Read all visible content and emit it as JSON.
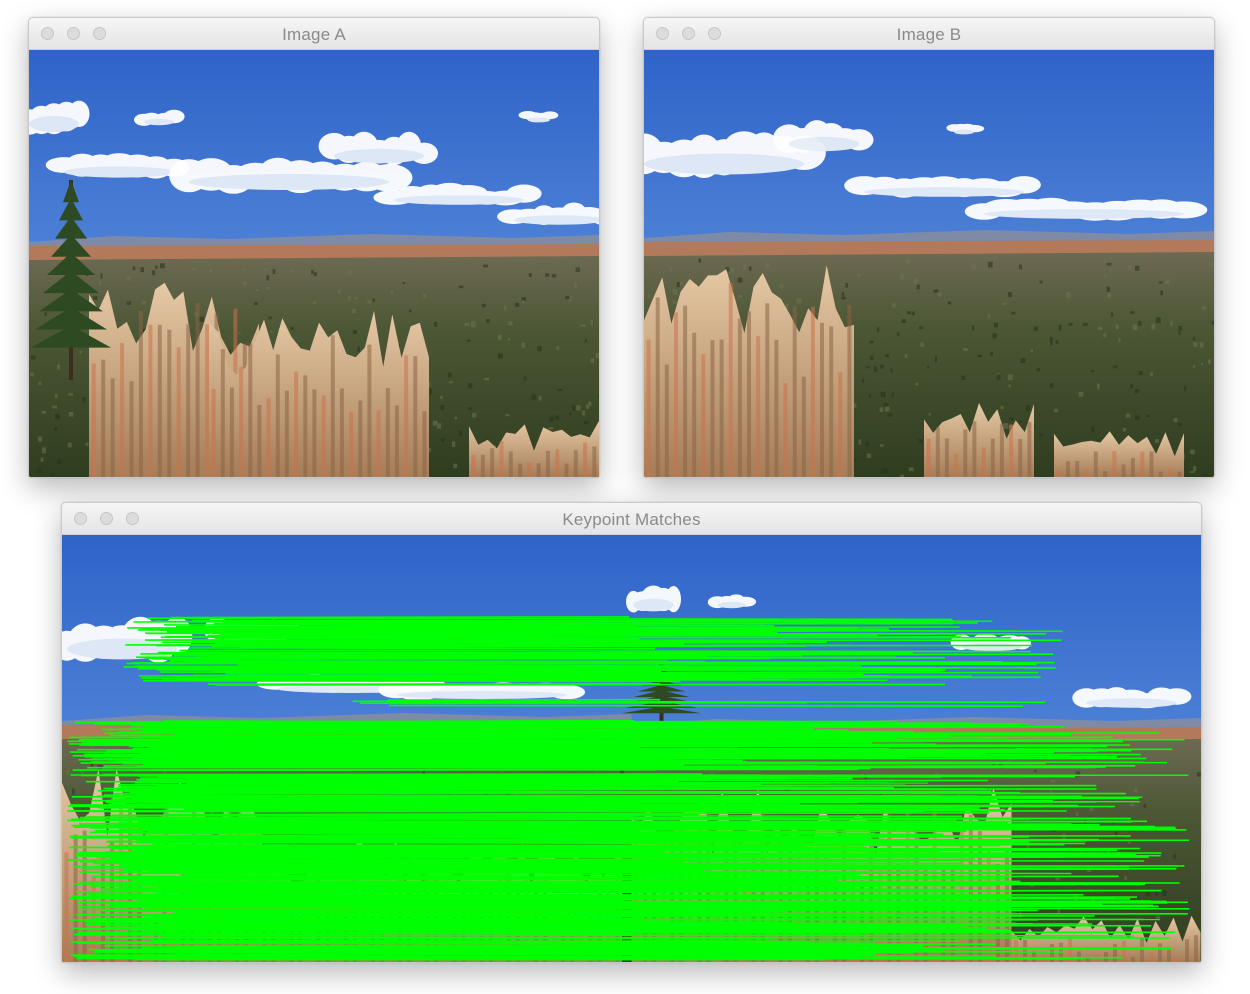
{
  "windows": {
    "image_a": {
      "title": "Image A"
    },
    "image_b": {
      "title": "Image B"
    },
    "matches": {
      "title": "Keypoint Matches"
    }
  },
  "colors": {
    "sky_top": "#2f63c8",
    "sky_horizon": "#a9c9ee",
    "forest": "#3f4f2c",
    "rock": "#c9a27c",
    "hoodoo": "#c8724a",
    "match_line": "#00ff00"
  },
  "icons": [
    "close-dot",
    "minimize-dot",
    "zoom-dot"
  ]
}
